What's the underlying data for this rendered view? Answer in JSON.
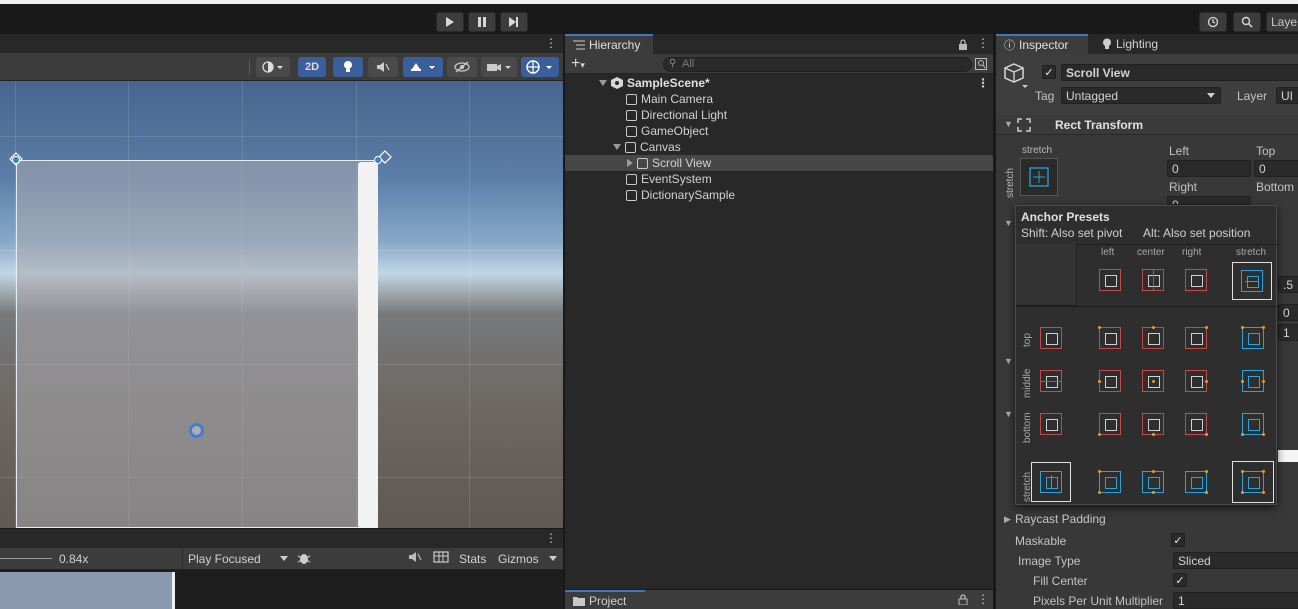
{
  "toolbar": {
    "play_icon": "play-icon",
    "pause_icon": "pause-icon",
    "step_icon": "step-icon",
    "history_icon": "history-icon",
    "search_icon": "search-icon",
    "layers_label": "Laye"
  },
  "scene": {
    "mode_2d": "2D"
  },
  "game": {
    "scale": "0.84x",
    "play_mode": "Play Focused",
    "stats": "Stats",
    "gizmos": "Gizmos"
  },
  "hierarchy": {
    "tab": "Hierarchy",
    "search_placeholder": "All",
    "scene_name": "SampleScene*",
    "items": [
      {
        "label": "Main Camera"
      },
      {
        "label": "Directional Light"
      },
      {
        "label": "GameObject"
      },
      {
        "label": "Canvas"
      },
      {
        "label": "Scroll View"
      },
      {
        "label": "EventSystem"
      },
      {
        "label": "DictionarySample"
      }
    ]
  },
  "project": {
    "tab": "Project"
  },
  "inspector": {
    "tab": "Inspector",
    "lighting_tab": "Lighting",
    "object_name": "Scroll View",
    "tag_label": "Tag",
    "tag_value": "Untagged",
    "layer_label": "Layer",
    "layer_value": "UI",
    "rect_transform": "Rect Transform",
    "stretch_top": "stretch",
    "stretch_side": "stretch",
    "left_label": "Left",
    "left_value": "0",
    "top_label": "Top",
    "top_value": "0",
    "right_label": "Right",
    "right_value": "0",
    "bottom_label": "Bottom",
    "partial_values": [
      ".5",
      "0",
      "1"
    ],
    "raycast_padding": "Raycast Padding",
    "maskable": "Maskable",
    "image_type": "Image Type",
    "image_type_value": "Sliced",
    "fill_center": "Fill Center",
    "ppu_label": "Pixels Per Unit Multiplier",
    "ppu_value": "1"
  },
  "anchor_presets": {
    "title": "Anchor Presets",
    "hint_shift": "Shift: Also set pivot",
    "hint_alt": "Alt: Also set position",
    "columns": [
      "left",
      "center",
      "right",
      "stretch"
    ],
    "rows": [
      "top",
      "middle",
      "bottom",
      "stretch"
    ]
  },
  "colors": {
    "accent": "#3a79bb",
    "anchor_red": "#c44a4a",
    "anchor_blue": "#2fa0d8",
    "pivot_orange": "#e0a030"
  }
}
